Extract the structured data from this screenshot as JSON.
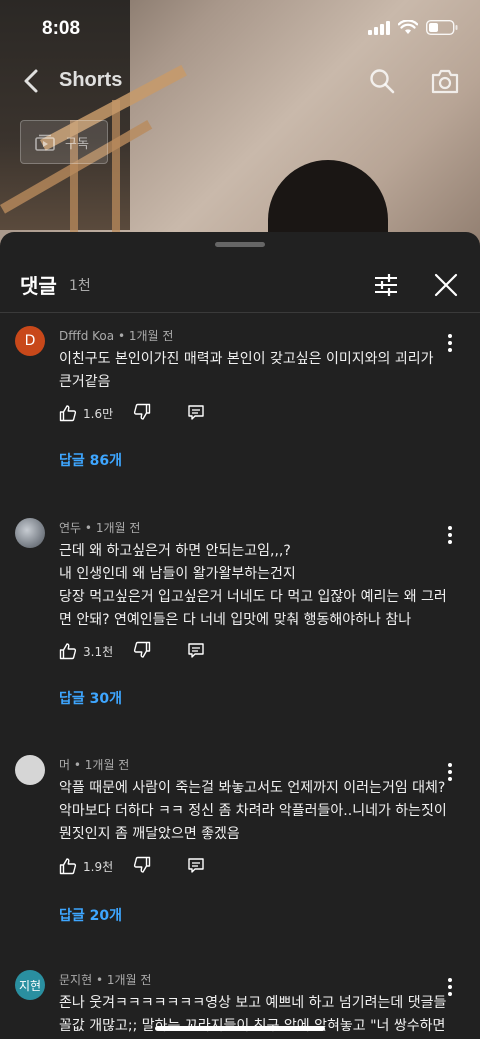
{
  "status_bar": {
    "time": "8:08"
  },
  "header": {
    "title": "Shorts",
    "subscribe_label": "구독"
  },
  "panel": {
    "title": "댓글",
    "count": "1천"
  },
  "comments": [
    {
      "author": "Dfffd Koa",
      "time": "1개월 전",
      "avatar_letter": "D",
      "avatar_color": "#c8481a",
      "lines": [
        "이친구도 본인이가진 매력과 본인이 갖고싶은 이미지와의 괴리가",
        "큰거같음"
      ],
      "likes": "1.6만",
      "replies": "답글 86개"
    },
    {
      "author": "연두",
      "time": "1개월 전",
      "avatar_letter": "",
      "avatar_color": "#8a8f96",
      "lines": [
        "근데 왜 하고싶은거 하면 안되는고임,,,?",
        "내 인생인데 왜 남들이 왈가왈부하는건지",
        "당장 먹고싶은거 입고싶은거 너네도 다 먹고 입잖아 예리는 왜 그러",
        "면 안돼? 연예인들은 다 너네 입맛에 맞춰 행동해야하나 참나"
      ],
      "likes": "3.1천",
      "replies": "답글 30개"
    },
    {
      "author": "머",
      "time": "1개월 전",
      "avatar_letter": "",
      "avatar_color": "#d6d6d6",
      "lines": [
        "악플 때문에 사람이 죽는걸 봐놓고서도 언제까지 이러는거임 대체?",
        "악마보다 더하다 ㅋㅋ 정신 좀 차려라 악플러들아..니네가 하는짓이",
        "뭔짓인지 좀 깨달았으면 좋겠음"
      ],
      "likes": "1.9천",
      "replies": "답글 20개"
    },
    {
      "author": "문지현",
      "time": "1개월 전",
      "avatar_letter": "지현",
      "avatar_color": "#2a8fa0",
      "lines": [
        "존나 웃겨ㅋㅋㅋㅋㅋㅋㅋ영상 보고 예쁘네 하고 넘기려는데 댓글들",
        "꼴값 개많고;; 말하는 꼬라지들이 친구 앞에 앉혀놓고 \"너 쌍수하면"
      ],
      "likes": "",
      "replies": ""
    }
  ]
}
